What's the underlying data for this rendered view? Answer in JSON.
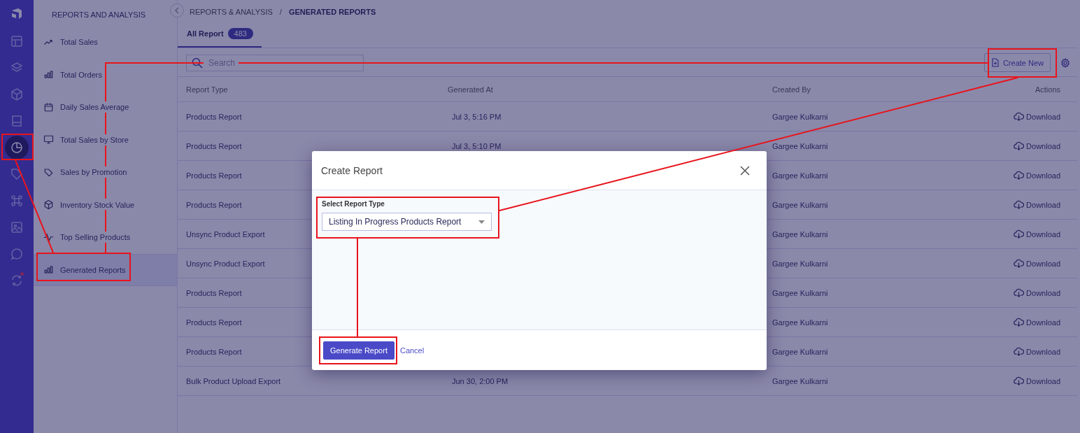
{
  "rail": {
    "items": [
      {
        "selected": false,
        "notification": false
      },
      {
        "selected": false,
        "notification": false
      },
      {
        "selected": false,
        "notification": false
      },
      {
        "selected": false,
        "notification": false
      },
      {
        "selected": true,
        "notification": false
      },
      {
        "selected": false,
        "notification": false
      },
      {
        "selected": false,
        "notification": false
      },
      {
        "selected": false,
        "notification": false
      },
      {
        "selected": false,
        "notification": false
      },
      {
        "selected": false,
        "notification": true
      }
    ]
  },
  "submenu": {
    "title": "REPORTS AND ANALYSIS",
    "items": [
      {
        "label": "Total Sales",
        "selected": false
      },
      {
        "label": "Total Orders",
        "selected": false
      },
      {
        "label": "Daily Sales Average",
        "selected": false
      },
      {
        "label": "Total Sales by Store",
        "selected": false
      },
      {
        "label": "Sales by Promotion",
        "selected": false
      },
      {
        "label": "Inventory Stock Value",
        "selected": false
      },
      {
        "label": "Top Selling Products",
        "selected": false
      },
      {
        "label": "Generated Reports",
        "selected": true
      }
    ]
  },
  "breadcrumb": {
    "items": [
      {
        "label": "REPORTS & ANALYSIS",
        "current": false
      },
      {
        "label": "GENERATED REPORTS",
        "current": true
      }
    ],
    "separator": "/"
  },
  "tabs": [
    {
      "label": "All Report",
      "count": "483",
      "selected": true
    }
  ],
  "search": {
    "placeholder": "Search"
  },
  "create_button": "Create New",
  "table": {
    "columns": [
      "Report Type",
      "Generated At",
      "Created By",
      "Actions"
    ],
    "rows": [
      {
        "report_type": "Products Report",
        "generated_at": "Jul 3, 5:16 PM",
        "created_by": "Gargee Kulkarni",
        "action": "Download"
      },
      {
        "report_type": "Products Report",
        "generated_at": "Jul 3, 5:10 PM",
        "created_by": "Gargee Kulkarni",
        "action": "Download"
      },
      {
        "report_type": "Products Report",
        "created_by": "Gargee Kulkarni",
        "action": "Download"
      },
      {
        "report_type": "Products Report",
        "created_by": "Gargee Kulkarni",
        "action": "Download"
      },
      {
        "report_type": "Unsync Product Export",
        "created_by": "Gargee Kulkarni",
        "action": "Download"
      },
      {
        "report_type": "Unsync Product Export",
        "created_by": "Gargee Kulkarni",
        "action": "Download"
      },
      {
        "report_type": "Products Report",
        "created_by": "Gargee Kulkarni",
        "action": "Download"
      },
      {
        "report_type": "Products Report",
        "created_by": "Gargee Kulkarni",
        "action": "Download"
      },
      {
        "report_type": "Products Report",
        "created_by": "Gargee Kulkarni",
        "action": "Download"
      },
      {
        "report_type": "Bulk Product Upload Export",
        "generated_at": "Jun 30, 2:00 PM",
        "created_by": "Gargee Kulkarni",
        "action": "Download"
      }
    ]
  },
  "modal": {
    "title": "Create Report",
    "field_label": "Select Report Type",
    "field_value": "Listing In Progress Products Report",
    "primary_button": "Generate Report",
    "secondary_link": "Cancel"
  }
}
